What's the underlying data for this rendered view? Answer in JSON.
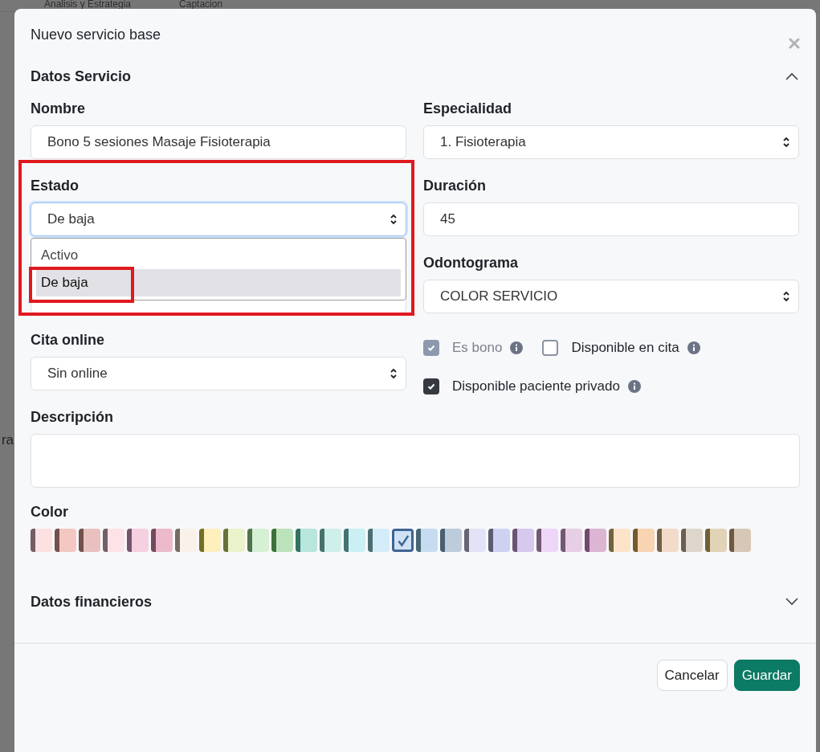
{
  "background": {
    "headers": [
      "Analisis y Estrategia",
      "Captacion"
    ],
    "fragment": "ra"
  },
  "modal": {
    "title": "Nuevo servicio base",
    "section": {
      "title": "Datos Servicio",
      "expanded": true
    },
    "left_fields": [
      {
        "kind": "text",
        "label": "Nombre",
        "value": "Bono 5 sesiones Masaje Fisioterapia"
      },
      {
        "kind": "select",
        "label": "Estado",
        "value": "De baja",
        "open": true,
        "highlighted": true,
        "options": [
          {
            "label": "Activo",
            "selected": false,
            "highlighted": false
          },
          {
            "label": "De baja",
            "selected": true,
            "highlighted": true
          }
        ]
      },
      {
        "kind": "covered"
      },
      {
        "kind": "select",
        "label": "Cita online",
        "value": "Sin online"
      }
    ],
    "right_fields": [
      {
        "kind": "select",
        "label": "Especialidad",
        "value": "1. Fisioterapia"
      },
      {
        "kind": "text",
        "label": "Duración",
        "value": "45"
      },
      {
        "kind": "select",
        "label": "Odontograma",
        "value": "COLOR SERVICIO"
      }
    ],
    "checkboxes": [
      {
        "label": "Es bono",
        "checked": true,
        "disabled": true
      },
      {
        "label": "Disponible en cita",
        "checked": false,
        "disabled": false
      },
      {
        "label": "Disponible paciente privado",
        "checked": true,
        "disabled": false
      }
    ],
    "description": {
      "label": "Descripción"
    },
    "color": {
      "label": "Color",
      "swatches": [
        {
          "color": "#fde0e2",
          "selected": false
        },
        {
          "color": "#f4c7c3",
          "selected": false
        },
        {
          "color": "#e8c1be",
          "selected": false
        },
        {
          "color": "#fde2e7",
          "selected": false
        },
        {
          "color": "#f5d0e0",
          "selected": false
        },
        {
          "color": "#ecbacb",
          "selected": false
        },
        {
          "color": "#faf2ea",
          "selected": false
        },
        {
          "color": "#fdf0bd",
          "selected": false
        },
        {
          "color": "#eaf2cb",
          "selected": false
        },
        {
          "color": "#d6f0d4",
          "selected": false
        },
        {
          "color": "#bce2bb",
          "selected": false
        },
        {
          "color": "#b8e6dc",
          "selected": false
        },
        {
          "color": "#cfefea",
          "selected": false
        },
        {
          "color": "#cbf0f3",
          "selected": false
        },
        {
          "color": "#d3ecf8",
          "selected": false
        },
        {
          "color": "#cfe1f5",
          "selected": true
        },
        {
          "color": "#c5dcf0",
          "selected": false
        },
        {
          "color": "#bdccdb",
          "selected": false
        },
        {
          "color": "#e3e3f7",
          "selected": false
        },
        {
          "color": "#cfd1f3",
          "selected": false
        },
        {
          "color": "#d7c8ee",
          "selected": false
        },
        {
          "color": "#eed6f8",
          "selected": false
        },
        {
          "color": "#e6cfe4",
          "selected": false
        },
        {
          "color": "#dbb5d2",
          "selected": false
        },
        {
          "color": "#fde4c8",
          "selected": false
        },
        {
          "color": "#f8d4b3",
          "selected": false
        },
        {
          "color": "#f2dbc9",
          "selected": false
        },
        {
          "color": "#dfd6cb",
          "selected": false
        },
        {
          "color": "#e1d4b6",
          "selected": false
        },
        {
          "color": "#d7c7b7",
          "selected": false
        }
      ]
    },
    "financial_section": {
      "title": "Datos financieros",
      "expanded": false
    },
    "buttons": [
      {
        "kind": "secondary",
        "label": "Cancelar"
      },
      {
        "kind": "primary",
        "label": "Guardar"
      }
    ]
  }
}
